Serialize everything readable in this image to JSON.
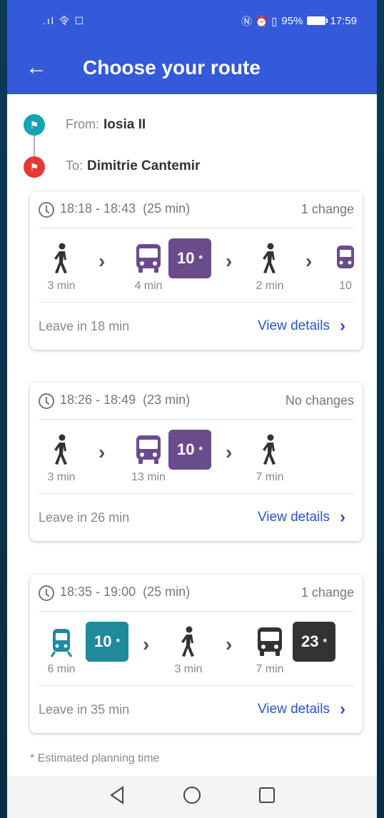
{
  "status_bar": {
    "signal": ".ıl 令 ☐",
    "icons": "Ⓝ ⏰ ▯",
    "battery_percent": "95%",
    "time": "17:59"
  },
  "app_bar": {
    "title": "Choose your route"
  },
  "stops": {
    "from_label": "From:",
    "from_value": "Iosia II",
    "to_label": "To:",
    "to_value": "Dimitrie Cantemir"
  },
  "routes": [
    {
      "time_range": "18:18 - 18:43",
      "duration": "(25 min)",
      "changes": "1 change",
      "legs": [
        {
          "mode": "walk",
          "duration": "3 min"
        },
        {
          "mode": "bus",
          "duration": "4 min",
          "line": "10",
          "color": "#6a4c8c"
        },
        {
          "mode": "walk",
          "duration": "2 min"
        },
        {
          "mode": "tram",
          "duration": "10"
        }
      ],
      "leave": "Leave in 18 min",
      "details_label": "View details"
    },
    {
      "time_range": "18:26 - 18:49",
      "duration": "(23 min)",
      "changes": "No changes",
      "legs": [
        {
          "mode": "walk",
          "duration": "3 min"
        },
        {
          "mode": "bus",
          "duration": "13 min",
          "line": "10",
          "color": "#6a4c8c"
        },
        {
          "mode": "walk",
          "duration": "7 min"
        }
      ],
      "leave": "Leave in 26 min",
      "details_label": "View details"
    },
    {
      "time_range": "18:35 - 19:00",
      "duration": "(25 min)",
      "changes": "1 change",
      "legs": [
        {
          "mode": "tram",
          "duration": "6 min",
          "line": "10",
          "color": "#1e8a9c"
        },
        {
          "mode": "walk",
          "duration": "3 min"
        },
        {
          "mode": "bus",
          "duration": "7 min",
          "line": "23",
          "color": "#333333"
        }
      ],
      "leave": "Leave in 35 min",
      "details_label": "View details"
    }
  ],
  "badge_star": "*",
  "footnote": "* Estimated planning time"
}
